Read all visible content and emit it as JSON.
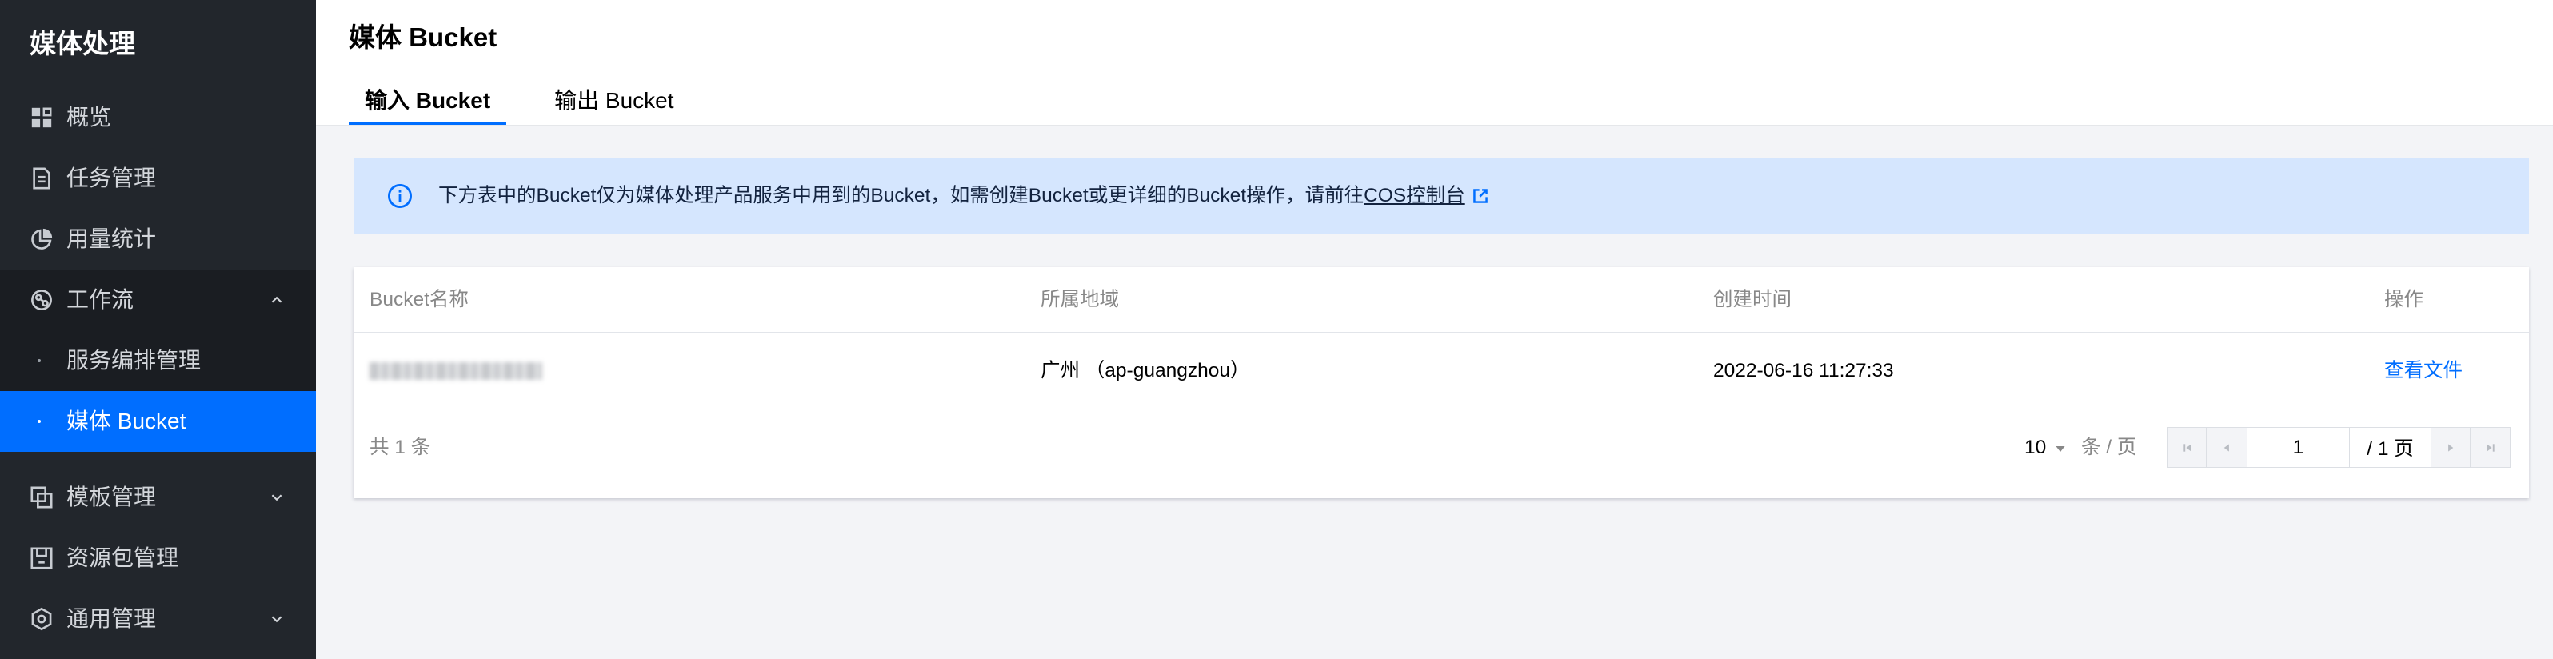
{
  "colors": {
    "accent": "#006eff",
    "sidebar_bg": "#22262c",
    "sidebar_group_bg": "#1a1d22",
    "page_bg": "#f3f4f7",
    "alert_bg": "#d5e6fe"
  },
  "sidebar": {
    "title": "媒体处理",
    "items": [
      {
        "label": "概览",
        "icon": "grid-icon"
      },
      {
        "label": "任务管理",
        "icon": "document-icon"
      },
      {
        "label": "用量统计",
        "icon": "pie-chart-icon"
      },
      {
        "label": "工作流",
        "icon": "workflow-icon",
        "expanded": true,
        "children": [
          {
            "label": "服务编排管理",
            "active": false
          },
          {
            "label": "媒体 Bucket",
            "active": true
          }
        ]
      },
      {
        "label": "模板管理",
        "icon": "template-icon",
        "expanded": false
      },
      {
        "label": "资源包管理",
        "icon": "package-icon"
      },
      {
        "label": "通用管理",
        "icon": "gear-icon",
        "expanded": false
      }
    ]
  },
  "header": {
    "title": "媒体 Bucket",
    "tabs": [
      {
        "label": "输入 Bucket",
        "active": true
      },
      {
        "label": "输出 Bucket",
        "active": false
      }
    ]
  },
  "alert": {
    "icon": "info-icon",
    "text": "下方表中的Bucket仅为媒体处理产品服务中用到的Bucket，如需创建Bucket或更详细的Bucket操作，请前往",
    "link": "COS控制台",
    "link_icon": "external-link-icon"
  },
  "table": {
    "columns": [
      "Bucket名称",
      "所属地域",
      "创建时间",
      "操作"
    ],
    "rows": [
      {
        "region": "广州 （ap-guangzhou）",
        "created": "2022-06-16 11:27:33",
        "action": "查看文件"
      }
    ]
  },
  "pagination": {
    "total_label": "共 1 条",
    "page_size": "10",
    "page_size_unit": "条 / 页",
    "current_page": "1",
    "total_pages_label": "/ 1 页"
  }
}
